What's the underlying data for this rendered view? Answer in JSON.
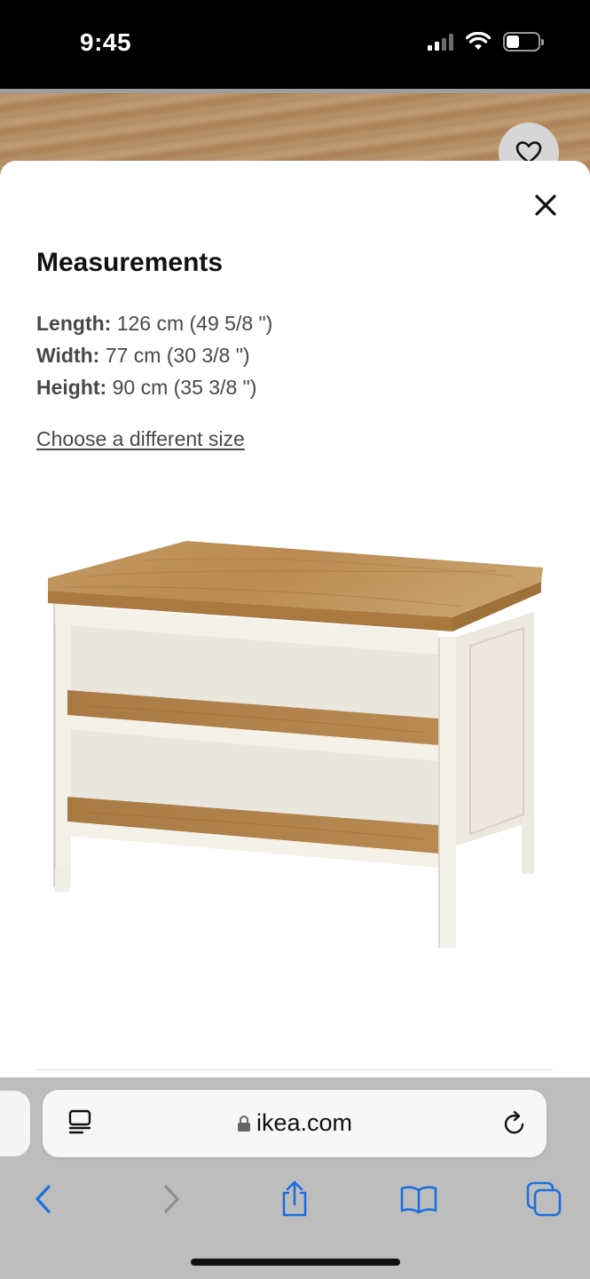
{
  "status_bar": {
    "time": "9:45"
  },
  "modal": {
    "title": "Measurements",
    "measurements": [
      {
        "label": "Length:",
        "value": " 126 cm (49 5/8 \")"
      },
      {
        "label": "Width:",
        "value": " 77 cm (30 3/8 \")"
      },
      {
        "label": "Height:",
        "value": " 90 cm (35 3/8 \")"
      }
    ],
    "change_size_link": "Choose a different size"
  },
  "browser": {
    "url": "ikea.com"
  },
  "icons": {
    "close": "close-icon",
    "favorite": "heart-icon",
    "reader": "reader-icon",
    "lock": "lock-icon",
    "reload": "reload-icon",
    "back": "chevron-left-icon",
    "forward": "chevron-right-icon",
    "share": "share-icon",
    "bookmarks": "book-icon",
    "tabs": "tabs-icon"
  },
  "colors": {
    "accent": "#1a6fe0",
    "text": "#484848",
    "wood": "#b8874f",
    "cabinet": "#f1ede2"
  }
}
